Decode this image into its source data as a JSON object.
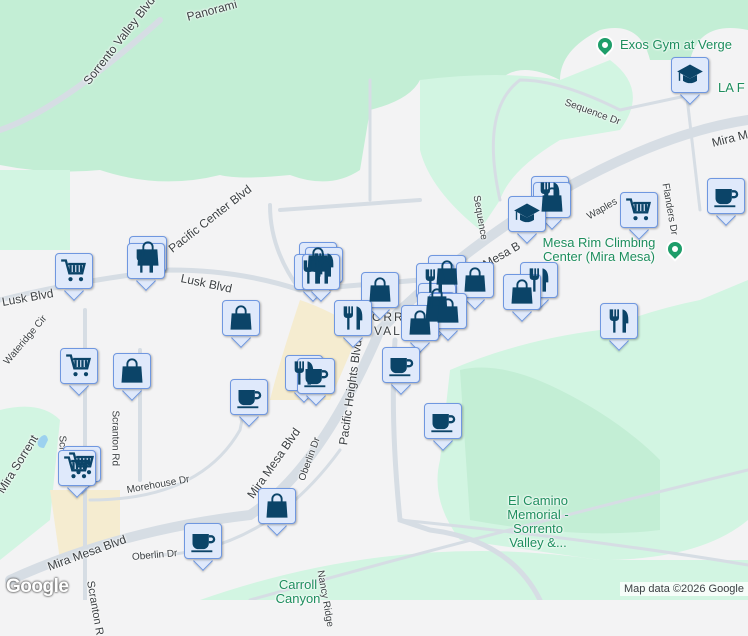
{
  "roads": {
    "sorrento_valley": "Sorrento Valley Blvd",
    "panorama": "Panorami",
    "pacific_center": "Pacific Center Blvd",
    "lusk": "Lusk Blvd",
    "lusk_west": "Lusk Blvd",
    "wateridge": "Wateridge Cir",
    "scranton1": "Scranton",
    "scranton_rd": "Scranton Rd",
    "scranton2": "Scranton R",
    "mira_sorrento": "Mira Sorrent",
    "morehouse": "Morehouse Dr",
    "mira_mesa_w": "Mira Mesa Blvd",
    "mira_mesa_mid": "Mira Mesa Blvd",
    "oberlin1": "Oberlin Dr",
    "oberlin2": "Oberlin Dr",
    "pacific_heights": "Pacific Heights Blvd",
    "nancy": "Nancy Ridge",
    "sequence1": "Sequence Dr",
    "sequence2": "Sequence",
    "mesa": "Mesa B",
    "waples": "Waples",
    "mira_ne": "Mira M",
    "flanders": "Flanders Dr"
  },
  "places": {
    "exos": "Exos Gym at Verge",
    "la_f": "LA F",
    "mesa_rim": "Mesa Rim Climbing Center (Mira Mesa)",
    "el_camino": "El Camino Memorial - Sorrento Valley &...",
    "carroll": "Carroll Canyon",
    "area1": "ORR",
    "area2": "VAL"
  },
  "markers": [
    "cart",
    "restaurant",
    "shopping",
    "coffee",
    "graduation"
  ],
  "footer": {
    "logo": "Google",
    "attribution": "Map data ©2026 Google"
  },
  "colors": {
    "park": "#c3eed5",
    "park_light": "#d2f5e2",
    "road": "#d6dde4",
    "marker_bg": "#dfe9fb",
    "icon": "#0b4468",
    "poi": "#1e8e5e"
  }
}
